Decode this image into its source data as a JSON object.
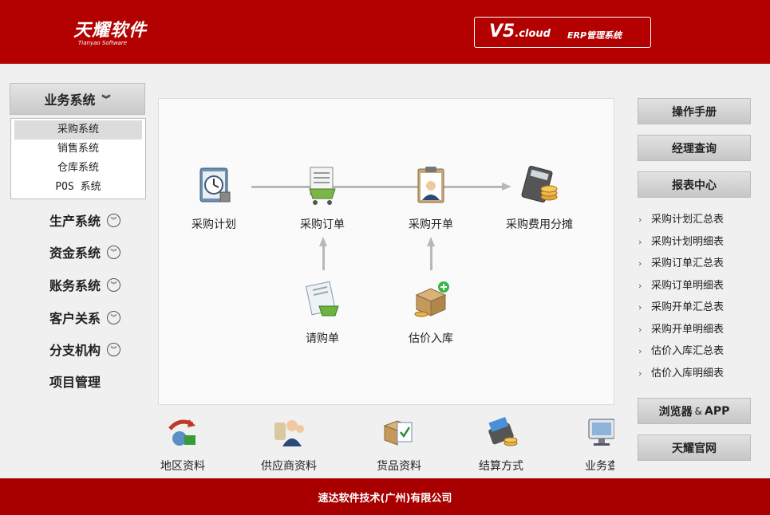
{
  "header": {
    "brand_name": "天耀软件",
    "brand_sub": "Tianyao Software",
    "version_main": "V5",
    "version_suffix": ".cloud",
    "version_label": "ERP管理系统"
  },
  "sidebar": {
    "active_menu": "业务系统",
    "submenu": [
      "采购系统",
      "销售系统",
      "仓库系统",
      "POS 系统"
    ],
    "items": [
      "生产系统",
      "资金系统",
      "账务系统",
      "客户关系",
      "分支机构",
      "项目管理"
    ]
  },
  "flow": {
    "plan": "采购计划",
    "order": "采购订单",
    "invoice": "采购开单",
    "cost": "采购费用分摊",
    "request": "请购单",
    "estimate": "估价入库"
  },
  "strip": [
    "地区资料",
    "供应商资料",
    "货品资料",
    "结算方式",
    "业务查"
  ],
  "right_panel": {
    "manual": "操作手册",
    "manager_query": "经理查询",
    "report_center": "报表中心",
    "reports": [
      "采购计划汇总表",
      "采购计划明细表",
      "采购订单汇总表",
      "采购订单明细表",
      "采购开单汇总表",
      "采购开单明细表",
      "估价入库汇总表",
      "估价入库明细表"
    ],
    "browser": "浏览器",
    "amp": "&",
    "app": "APP",
    "official_site": "天耀官网"
  },
  "footer": {
    "company": "速达软件技术(广州)有限公司"
  },
  "colors": {
    "header_red": "#b30000",
    "footer_red": "#a80000"
  }
}
